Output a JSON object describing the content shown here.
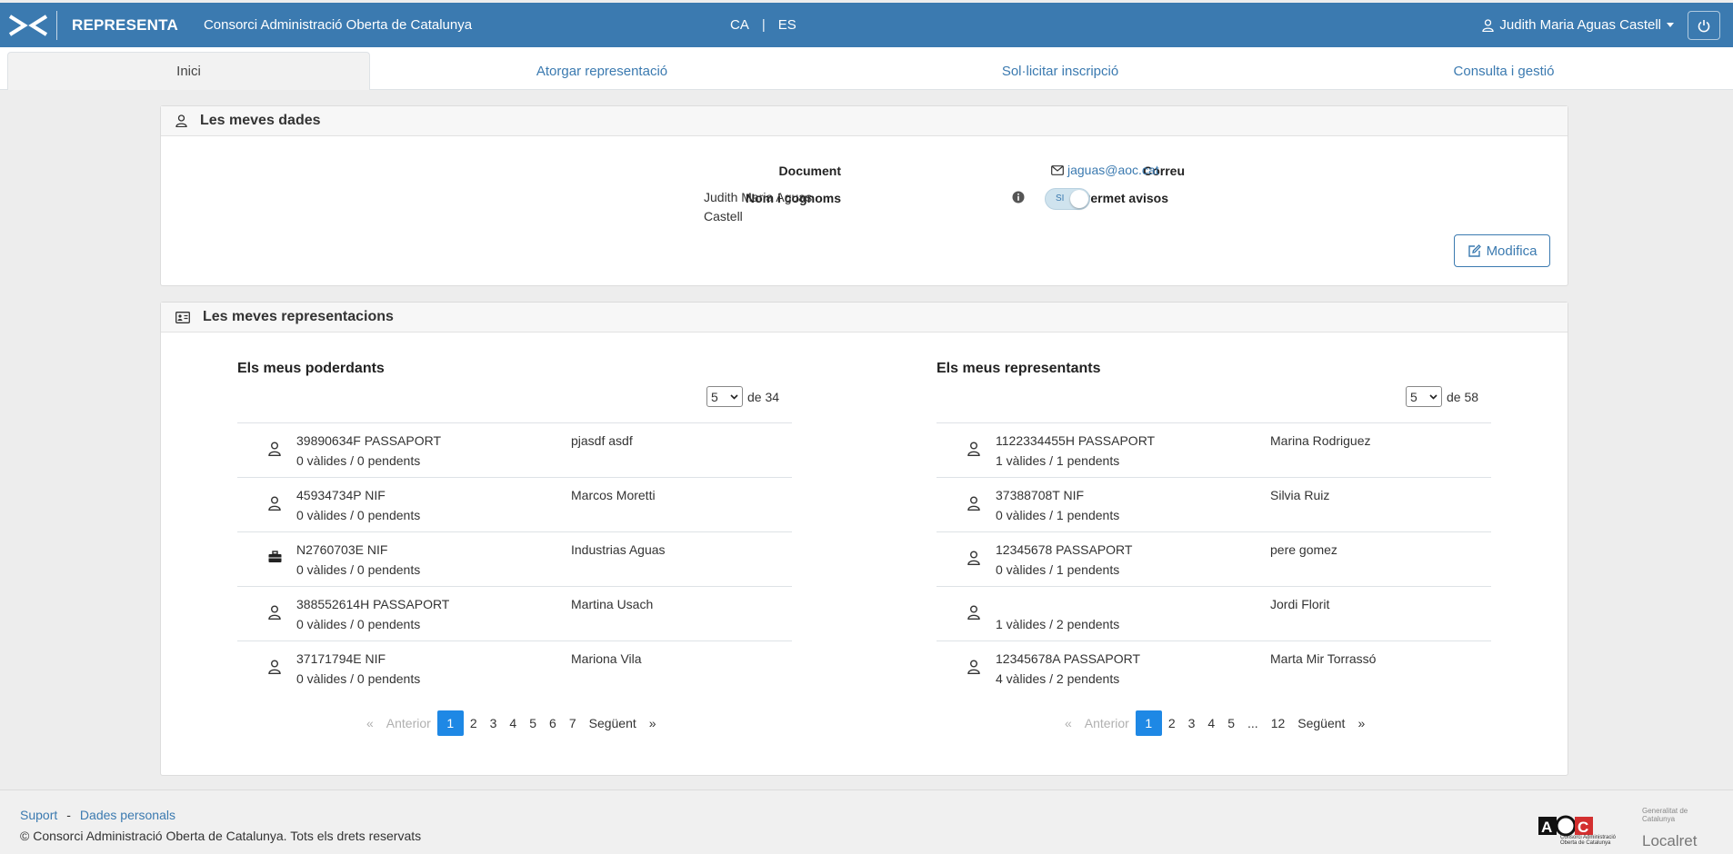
{
  "header": {
    "brand": "REPRESENTA",
    "org": "Consorci Administració Oberta de Catalunya",
    "lang_ca": "CA",
    "lang_sep": "|",
    "lang_es": "ES",
    "user": "Judith Maria Aguas Castell"
  },
  "tabs": [
    {
      "label": "Inici"
    },
    {
      "label": "Atorgar representació"
    },
    {
      "label": "Sol·licitar inscripció"
    },
    {
      "label": "Consulta i gestió"
    }
  ],
  "dades": {
    "title": "Les meves dades",
    "document_label": "Document",
    "document_value": "",
    "name_label": "Nom i cognoms",
    "name_value_line1": "Judith Maria Aguas",
    "name_value_line2": "Castell",
    "email_label": "Correu",
    "email_value": "jaguas@aoc.cat",
    "avisos_label": "Permet avisos",
    "avisos_state": "SI",
    "modify_button": "Modifica"
  },
  "representacions": {
    "title": "Les meves representacions",
    "poderdants": {
      "title": "Els meus poderdants",
      "page_size": "5",
      "total": "de 34",
      "rows": [
        {
          "icon": "person-icon",
          "doc": "39890634F PASSAPORT",
          "counts": "0 vàlides / 0 pendents",
          "name": "pjasdf asdf"
        },
        {
          "icon": "person-icon",
          "doc": "45934734P NIF",
          "counts": "0 vàlides / 0 pendents",
          "name": "Marcos Moretti"
        },
        {
          "icon": "briefcase-icon",
          "doc": "N2760703E NIF",
          "counts": "0 vàlides / 0 pendents",
          "name": "Industrias Aguas"
        },
        {
          "icon": "person-icon",
          "doc": "388552614H PASSAPORT",
          "counts": "0 vàlides / 0 pendents",
          "name": "Martina Usach"
        },
        {
          "icon": "person-icon",
          "doc": "37171794E NIF",
          "counts": "0 vàlides / 0 pendents",
          "name": "Mariona Vila"
        }
      ],
      "pager": {
        "prev": "Anterior",
        "prev_arrow": "«",
        "pages": [
          "1",
          "2",
          "3",
          "4",
          "5",
          "6",
          "7"
        ],
        "next": "Següent",
        "next_arrow": "»"
      }
    },
    "representants": {
      "title": "Els meus representants",
      "page_size": "5",
      "total": "de 58",
      "rows": [
        {
          "icon": "person-icon",
          "doc": "1122334455H PASSAPORT",
          "counts": "1 vàlides / 1 pendents",
          "name": "Marina Rodriguez"
        },
        {
          "icon": "person-icon",
          "doc": "37388708T NIF",
          "counts": "0 vàlides / 1 pendents",
          "name": "Silvia Ruiz"
        },
        {
          "icon": "person-icon",
          "doc": "12345678 PASSAPORT",
          "counts": "0 vàlides / 1 pendents",
          "name": "pere gomez"
        },
        {
          "icon": "person-icon",
          "doc": "",
          "counts": "1 vàlides / 2 pendents",
          "name": "Jordi Florit"
        },
        {
          "icon": "person-icon",
          "doc": "12345678A PASSAPORT",
          "counts": "4 vàlides / 2 pendents",
          "name": "Marta Mir Torrassó"
        }
      ],
      "pager": {
        "prev": "Anterior",
        "prev_arrow": "«",
        "pages": [
          "1",
          "2",
          "3",
          "4",
          "5",
          "...",
          "12"
        ],
        "next": "Següent",
        "next_arrow": "»"
      }
    }
  },
  "footer": {
    "support": "Suport",
    "sep": "-",
    "personal": "Dades personals",
    "copyright": "© Consorci Administració Oberta de Catalunya. Tots els drets reservats",
    "aoc_logo": "AOC",
    "aoc_sub": "Consorci Administració Oberta de Catalunya",
    "gencat": "Generalitat de Catalunya",
    "localret": "Localret"
  },
  "colors": {
    "primary": "#3b7ab0",
    "active_page": "#1e88e5"
  }
}
